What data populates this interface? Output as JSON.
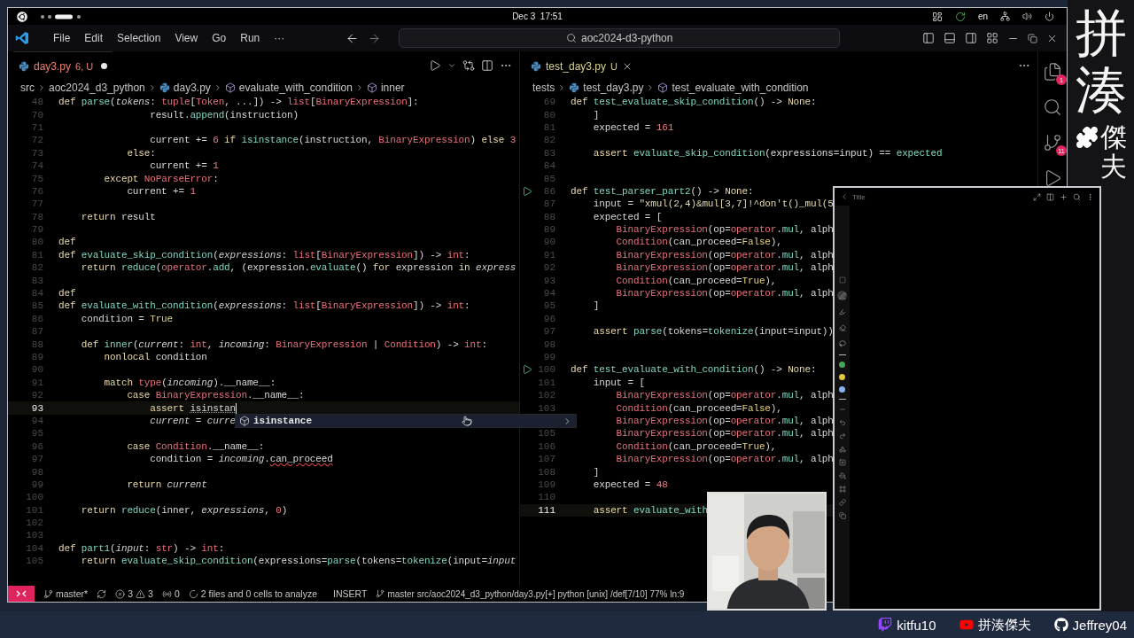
{
  "top_bar": {
    "clock": "Dec 3  17:51",
    "language": "en"
  },
  "window": {
    "menu": [
      "File",
      "Edit",
      "Selection",
      "View",
      "Go",
      "Run",
      "···"
    ],
    "command_center": "aoc2024-d3-python"
  },
  "editors": [
    {
      "focused": true,
      "tabs": [
        {
          "label": "day3.py",
          "detail": "6, U",
          "kind": "error",
          "modified": true,
          "selected": true
        }
      ],
      "actions": [
        {
          "kind": "run"
        },
        {
          "kind": "run-menu"
        },
        {
          "kind": "compare"
        },
        {
          "kind": "split"
        },
        {
          "kind": "more"
        }
      ],
      "breadcrumbs": [
        {
          "label": "src",
          "kind": "folder"
        },
        {
          "label": "aoc2024_d3_python",
          "kind": "folder"
        },
        {
          "label": "day3.py",
          "kind": "python"
        },
        {
          "label": "evaluate_with_condition",
          "kind": "symbol"
        },
        {
          "label": "inner",
          "kind": "symbol"
        }
      ],
      "lines": [
        {
          "n": "48",
          "current": false,
          "tokens": [
            {
              "kind": "kw",
              "text": "def "
            },
            {
              "kind": "fn",
              "text": "parse"
            },
            {
              "kind": "txt",
              "text": "("
            },
            {
              "kind": "param",
              "text": "tokens"
            },
            {
              "kind": "txt",
              "text": ": "
            },
            {
              "kind": "cls",
              "text": "tuple"
            },
            {
              "kind": "txt",
              "text": "["
            },
            {
              "kind": "cls",
              "text": "Token"
            },
            {
              "kind": "txt",
              "text": ", ...]) -> "
            },
            {
              "kind": "cls",
              "text": "list"
            },
            {
              "kind": "txt",
              "text": "["
            },
            {
              "kind": "cls",
              "text": "BinaryExpression"
            },
            {
              "kind": "txt",
              "text": "]:"
            }
          ]
        },
        {
          "n": "70",
          "current": false,
          "tokens": [
            {
              "kind": "txt",
              "text": "                result."
            },
            {
              "kind": "fn",
              "text": "append"
            },
            {
              "kind": "txt",
              "text": "(instruction)"
            }
          ]
        },
        {
          "n": "71",
          "current": false
        },
        {
          "n": "72",
          "current": false,
          "tokens": [
            {
              "kind": "txt",
              "text": "                current += "
            },
            {
              "kind": "num",
              "text": "6"
            },
            {
              "kind": "kw",
              "text": " if "
            },
            {
              "kind": "fn",
              "text": "isinstance"
            },
            {
              "kind": "txt",
              "text": "(instruction, "
            },
            {
              "kind": "cls",
              "text": "BinaryExpression"
            },
            {
              "kind": "txt",
              "text": ") "
            },
            {
              "kind": "kw",
              "text": "else "
            },
            {
              "kind": "num",
              "text": "3"
            }
          ]
        },
        {
          "n": "73",
          "current": false,
          "tokens": [
            {
              "kind": "kw",
              "text": "            else"
            },
            {
              "kind": "txt",
              "text": ":"
            }
          ]
        },
        {
          "n": "74",
          "current": false,
          "tokens": [
            {
              "kind": "txt",
              "text": "                current += "
            },
            {
              "kind": "num",
              "text": "1"
            }
          ]
        },
        {
          "n": "75",
          "current": false,
          "tokens": [
            {
              "kind": "kw",
              "text": "        except "
            },
            {
              "kind": "cls",
              "text": "NoParseError"
            },
            {
              "kind": "txt",
              "text": ":"
            }
          ]
        },
        {
          "n": "76",
          "current": false,
          "tokens": [
            {
              "kind": "txt",
              "text": "            current += "
            },
            {
              "kind": "num",
              "text": "1"
            }
          ]
        },
        {
          "n": "77",
          "current": false
        },
        {
          "n": "78",
          "current": false,
          "tokens": [
            {
              "kind": "kw",
              "text": "    return "
            },
            {
              "kind": "txt",
              "text": "result"
            }
          ]
        },
        {
          "n": "79",
          "current": false
        },
        {
          "n": "80",
          "current": false,
          "tokens": [
            {
              "kind": "kw",
              "text": "def"
            }
          ]
        },
        {
          "n": "81",
          "current": false,
          "tokens": [
            {
              "kind": "kw",
              "text": "def "
            },
            {
              "kind": "fn",
              "text": "evaluate_skip_condition"
            },
            {
              "kind": "txt",
              "text": "("
            },
            {
              "kind": "param",
              "text": "expressions"
            },
            {
              "kind": "txt",
              "text": ": "
            },
            {
              "kind": "cls",
              "text": "list"
            },
            {
              "kind": "txt",
              "text": "["
            },
            {
              "kind": "cls",
              "text": "BinaryExpression"
            },
            {
              "kind": "txt",
              "text": "]) -> "
            },
            {
              "kind": "cls",
              "text": "int"
            },
            {
              "kind": "txt",
              "text": ":"
            }
          ]
        },
        {
          "n": "82",
          "current": false,
          "tokens": [
            {
              "kind": "kw",
              "text": "    return "
            },
            {
              "kind": "fn",
              "text": "reduce"
            },
            {
              "kind": "txt",
              "text": "("
            },
            {
              "kind": "cls",
              "text": "operator"
            },
            {
              "kind": "txt",
              "text": "."
            },
            {
              "kind": "fn",
              "text": "add"
            },
            {
              "kind": "txt",
              "text": ", (expression."
            },
            {
              "kind": "fn",
              "text": "evaluate"
            },
            {
              "kind": "txt",
              "text": "() "
            },
            {
              "kind": "kw",
              "text": "for "
            },
            {
              "kind": "txt",
              "text": "expression "
            },
            {
              "kind": "kw",
              "text": "in "
            },
            {
              "kind": "param",
              "text": "express"
            }
          ]
        },
        {
          "n": "83",
          "current": false
        },
        {
          "n": "84",
          "current": false,
          "tokens": [
            {
              "kind": "kw",
              "text": "def"
            }
          ]
        },
        {
          "n": "85",
          "current": false,
          "tokens": [
            {
              "kind": "kw",
              "text": "def "
            },
            {
              "kind": "fn",
              "text": "evaluate_with_condition"
            },
            {
              "kind": "txt",
              "text": "("
            },
            {
              "kind": "param",
              "text": "expressions"
            },
            {
              "kind": "txt",
              "text": ": "
            },
            {
              "kind": "cls",
              "text": "list"
            },
            {
              "kind": "txt",
              "text": "["
            },
            {
              "kind": "cls",
              "text": "BinaryExpression"
            },
            {
              "kind": "txt",
              "text": "]) -> "
            },
            {
              "kind": "cls",
              "text": "int"
            },
            {
              "kind": "txt",
              "text": ":"
            }
          ]
        },
        {
          "n": "86",
          "current": false,
          "tokens": [
            {
              "kind": "txt",
              "text": "    condition = "
            },
            {
              "kind": "const",
              "text": "True"
            }
          ]
        },
        {
          "n": "87",
          "current": false
        },
        {
          "n": "88",
          "current": false,
          "tokens": [
            {
              "kind": "kw",
              "text": "    def "
            },
            {
              "kind": "fn",
              "text": "inner"
            },
            {
              "kind": "txt",
              "text": "("
            },
            {
              "kind": "param",
              "text": "current"
            },
            {
              "kind": "txt",
              "text": ": "
            },
            {
              "kind": "cls",
              "text": "int"
            },
            {
              "kind": "txt",
              "text": ", "
            },
            {
              "kind": "param",
              "text": "incoming"
            },
            {
              "kind": "txt",
              "text": ": "
            },
            {
              "kind": "cls",
              "text": "BinaryExpression"
            },
            {
              "kind": "txt",
              "text": " | "
            },
            {
              "kind": "cls",
              "text": "Condition"
            },
            {
              "kind": "txt",
              "text": ") -> "
            },
            {
              "kind": "cls",
              "text": "int"
            },
            {
              "kind": "txt",
              "text": ":"
            }
          ]
        },
        {
          "n": "89",
          "current": false,
          "tokens": [
            {
              "kind": "kw",
              "text": "        nonlocal "
            },
            {
              "kind": "txt",
              "text": "condition"
            }
          ]
        },
        {
          "n": "90",
          "current": false
        },
        {
          "n": "91",
          "current": false,
          "tokens": [
            {
              "kind": "kw",
              "text": "        match "
            },
            {
              "kind": "cls",
              "text": "type"
            },
            {
              "kind": "txt",
              "text": "("
            },
            {
              "kind": "param",
              "text": "incoming"
            },
            {
              "kind": "txt",
              "text": ").__name__:"
            }
          ]
        },
        {
          "n": "92",
          "current": false,
          "tokens": [
            {
              "kind": "kw",
              "text": "            case "
            },
            {
              "kind": "cls",
              "text": "BinaryExpression"
            },
            {
              "kind": "txt",
              "text": ".__name__:"
            }
          ]
        },
        {
          "n": "93",
          "current": true,
          "tokens": [
            {
              "kind": "kw",
              "text": "                assert "
            },
            {
              "kind": "hint",
              "text": "isinstan"
            }
          ]
        },
        {
          "n": "94",
          "current": false,
          "tokens": [
            {
              "kind": "param",
              "text": "                current"
            },
            {
              "kind": "txt",
              "text": " = "
            },
            {
              "kind": "param",
              "text": "curre"
            }
          ]
        },
        {
          "n": "95",
          "current": false
        },
        {
          "n": "96",
          "current": false,
          "tokens": [
            {
              "kind": "kw",
              "text": "            case "
            },
            {
              "kind": "cls",
              "text": "Condition"
            },
            {
              "kind": "txt",
              "text": ".__name__:"
            }
          ]
        },
        {
          "n": "97",
          "current": false,
          "tokens": [
            {
              "kind": "txt",
              "text": "                condition = "
            },
            {
              "kind": "param",
              "text": "incoming"
            },
            {
              "kind": "txt",
              "text": "."
            },
            {
              "kind": "err",
              "text": "can_proceed"
            }
          ]
        },
        {
          "n": "98",
          "current": false
        },
        {
          "n": "99",
          "current": false,
          "tokens": [
            {
              "kind": "kw",
              "text": "            return "
            },
            {
              "kind": "param",
              "text": "current"
            }
          ]
        },
        {
          "n": "100",
          "current": false
        },
        {
          "n": "101",
          "current": false,
          "tokens": [
            {
              "kind": "kw",
              "text": "    return "
            },
            {
              "kind": "fn",
              "text": "reduce"
            },
            {
              "kind": "txt",
              "text": "(inner, "
            },
            {
              "kind": "param",
              "text": "expressions"
            },
            {
              "kind": "txt",
              "text": ", "
            },
            {
              "kind": "num",
              "text": "0"
            },
            {
              "kind": "txt",
              "text": ")"
            }
          ]
        },
        {
          "n": "102",
          "current": false
        },
        {
          "n": "103",
          "current": false
        },
        {
          "n": "104",
          "current": false,
          "tokens": [
            {
              "kind": "kw",
              "text": "def "
            },
            {
              "kind": "fn",
              "text": "part1"
            },
            {
              "kind": "txt",
              "text": "("
            },
            {
              "kind": "param",
              "text": "input"
            },
            {
              "kind": "txt",
              "text": ": "
            },
            {
              "kind": "cls",
              "text": "str"
            },
            {
              "kind": "txt",
              "text": ") -> "
            },
            {
              "kind": "cls",
              "text": "int"
            },
            {
              "kind": "txt",
              "text": ":"
            }
          ]
        },
        {
          "n": "105",
          "current": false,
          "tokens": [
            {
              "kind": "kw",
              "text": "    return "
            },
            {
              "kind": "fn",
              "text": "evaluate_skip_condition"
            },
            {
              "kind": "txt",
              "text": "(expressions="
            },
            {
              "kind": "fn",
              "text": "parse"
            },
            {
              "kind": "txt",
              "text": "(tokens="
            },
            {
              "kind": "fn",
              "text": "tokenize"
            },
            {
              "kind": "txt",
              "text": "(input="
            },
            {
              "kind": "param",
              "text": "input"
            }
          ]
        }
      ]
    },
    {
      "focused": false,
      "tabs": [
        {
          "label": "test_day3.py",
          "detail": "U",
          "kind": "untracked",
          "modified": false,
          "selected": true
        }
      ],
      "actions": [
        {
          "kind": "more"
        }
      ],
      "breadcrumbs": [
        {
          "label": "tests",
          "kind": "folder"
        },
        {
          "label": "test_day3.py",
          "kind": "python"
        },
        {
          "label": "test_evaluate_with_condition",
          "kind": "symbol"
        }
      ],
      "lines": [
        {
          "n": "69",
          "current": false,
          "tokens": [
            {
              "kind": "kw",
              "text": "def "
            },
            {
              "kind": "fn",
              "text": "test_evaluate_skip_condition"
            },
            {
              "kind": "txt",
              "text": "() -> "
            },
            {
              "kind": "kw",
              "text": "None"
            },
            {
              "kind": "txt",
              "text": ":"
            }
          ]
        },
        {
          "n": "80",
          "current": false,
          "tokens": [
            {
              "kind": "txt",
              "text": "    ]"
            }
          ]
        },
        {
          "n": "81",
          "current": false,
          "tokens": [
            {
              "kind": "txt",
              "text": "    expected = "
            },
            {
              "kind": "num",
              "text": "161"
            }
          ]
        },
        {
          "n": "82",
          "current": false
        },
        {
          "n": "83",
          "current": false,
          "tokens": [
            {
              "kind": "kw",
              "text": "    assert "
            },
            {
              "kind": "fn",
              "text": "evaluate_skip_condition"
            },
            {
              "kind": "txt",
              "text": "(expressions=input) == "
            },
            {
              "kind": "fn",
              "text": "expected"
            }
          ]
        },
        {
          "n": "84",
          "current": false
        },
        {
          "n": "85",
          "current": false
        },
        {
          "n": "86",
          "current": false,
          "runnable": true,
          "tokens": [
            {
              "kind": "kw",
              "text": "def "
            },
            {
              "kind": "fn",
              "text": "test_parser_part2"
            },
            {
              "kind": "txt",
              "text": "() -> "
            },
            {
              "kind": "kw",
              "text": "None"
            },
            {
              "kind": "txt",
              "text": ":"
            }
          ]
        },
        {
          "n": "87",
          "current": false,
          "tokens": [
            {
              "kind": "txt",
              "text": "    input = "
            },
            {
              "kind": "str",
              "text": "\"xmul(2,4)&mul[3,7]!^don't()_mul(5"
            }
          ]
        },
        {
          "n": "88",
          "current": false,
          "tokens": [
            {
              "kind": "txt",
              "text": "    expected = ["
            }
          ]
        },
        {
          "n": "89",
          "current": false,
          "tokens": [
            {
              "kind": "cls",
              "text": "        BinaryExpression"
            },
            {
              "kind": "txt",
              "text": "(op="
            },
            {
              "kind": "cls",
              "text": "operator"
            },
            {
              "kind": "txt",
              "text": "."
            },
            {
              "kind": "fn",
              "text": "mul"
            },
            {
              "kind": "txt",
              "text": ", alph"
            }
          ]
        },
        {
          "n": "90",
          "current": false,
          "tokens": [
            {
              "kind": "cls",
              "text": "        Condition"
            },
            {
              "kind": "txt",
              "text": "(can_proceed="
            },
            {
              "kind": "const",
              "text": "False"
            },
            {
              "kind": "txt",
              "text": "),"
            }
          ]
        },
        {
          "n": "91",
          "current": false,
          "tokens": [
            {
              "kind": "cls",
              "text": "        BinaryExpression"
            },
            {
              "kind": "txt",
              "text": "(op="
            },
            {
              "kind": "cls",
              "text": "operator"
            },
            {
              "kind": "txt",
              "text": "."
            },
            {
              "kind": "fn",
              "text": "mul"
            },
            {
              "kind": "txt",
              "text": ", alph"
            }
          ]
        },
        {
          "n": "92",
          "current": false,
          "tokens": [
            {
              "kind": "cls",
              "text": "        BinaryExpression"
            },
            {
              "kind": "txt",
              "text": "(op="
            },
            {
              "kind": "cls",
              "text": "operator"
            },
            {
              "kind": "txt",
              "text": "."
            },
            {
              "kind": "fn",
              "text": "mul"
            },
            {
              "kind": "txt",
              "text": ", alph"
            }
          ]
        },
        {
          "n": "93",
          "current": false,
          "tokens": [
            {
              "kind": "cls",
              "text": "        Condition"
            },
            {
              "kind": "txt",
              "text": "(can_proceed="
            },
            {
              "kind": "const",
              "text": "True"
            },
            {
              "kind": "txt",
              "text": "),"
            }
          ]
        },
        {
          "n": "94",
          "current": false,
          "tokens": [
            {
              "kind": "cls",
              "text": "        BinaryExpression"
            },
            {
              "kind": "txt",
              "text": "(op="
            },
            {
              "kind": "cls",
              "text": "operator"
            },
            {
              "kind": "txt",
              "text": "."
            },
            {
              "kind": "fn",
              "text": "mul"
            },
            {
              "kind": "txt",
              "text": ", alph"
            }
          ]
        },
        {
          "n": "95",
          "current": false,
          "tokens": [
            {
              "kind": "txt",
              "text": "    ]"
            }
          ]
        },
        {
          "n": "96",
          "current": false
        },
        {
          "n": "97",
          "current": false,
          "tokens": [
            {
              "kind": "kw",
              "text": "    assert "
            },
            {
              "kind": "fn",
              "text": "parse"
            },
            {
              "kind": "txt",
              "text": "(tokens="
            },
            {
              "kind": "fn",
              "text": "tokenize"
            },
            {
              "kind": "txt",
              "text": "(input=input))"
            }
          ]
        },
        {
          "n": "98",
          "current": false
        },
        {
          "n": "99",
          "current": false
        },
        {
          "n": "100",
          "current": false,
          "runnable": true,
          "tokens": [
            {
              "kind": "kw",
              "text": "def "
            },
            {
              "kind": "fn",
              "text": "test_evaluate_with_condition"
            },
            {
              "kind": "txt",
              "text": "() -> "
            },
            {
              "kind": "kw",
              "text": "None"
            },
            {
              "kind": "txt",
              "text": ":"
            }
          ]
        },
        {
          "n": "101",
          "current": false,
          "tokens": [
            {
              "kind": "txt",
              "text": "    input = ["
            }
          ]
        },
        {
          "n": "102",
          "current": false,
          "tokens": [
            {
              "kind": "cls",
              "text": "        BinaryExpression"
            },
            {
              "kind": "txt",
              "text": "(op="
            },
            {
              "kind": "cls",
              "text": "operator"
            },
            {
              "kind": "txt",
              "text": "."
            },
            {
              "kind": "fn",
              "text": "mul"
            },
            {
              "kind": "txt",
              "text": ", alph"
            }
          ]
        },
        {
          "n": "103",
          "current": false,
          "tokens": [
            {
              "kind": "cls",
              "text": "        Condition"
            },
            {
              "kind": "txt",
              "text": "(can_proceed="
            },
            {
              "kind": "const",
              "text": "False"
            },
            {
              "kind": "txt",
              "text": "),"
            }
          ]
        },
        {
          "current": false,
          "tokens": [
            {
              "kind": "cls",
              "text": "        BinaryExpression"
            },
            {
              "kind": "txt",
              "text": "(op="
            },
            {
              "kind": "cls",
              "text": "operator"
            },
            {
              "kind": "txt",
              "text": "."
            },
            {
              "kind": "fn",
              "text": "mul"
            },
            {
              "kind": "txt",
              "text": ", alph"
            }
          ]
        },
        {
          "n": "105",
          "current": false,
          "tokens": [
            {
              "kind": "cls",
              "text": "        BinaryExpression"
            },
            {
              "kind": "txt",
              "text": "(op="
            },
            {
              "kind": "cls",
              "text": "operator"
            },
            {
              "kind": "txt",
              "text": "."
            },
            {
              "kind": "fn",
              "text": "mul"
            },
            {
              "kind": "txt",
              "text": ", alph"
            }
          ]
        },
        {
          "n": "106",
          "current": false,
          "tokens": [
            {
              "kind": "cls",
              "text": "        Condition"
            },
            {
              "kind": "txt",
              "text": "(can_proceed="
            },
            {
              "kind": "const",
              "text": "True"
            },
            {
              "kind": "txt",
              "text": "),"
            }
          ]
        },
        {
          "n": "107",
          "current": false,
          "tokens": [
            {
              "kind": "cls",
              "text": "        BinaryExpression"
            },
            {
              "kind": "txt",
              "text": "(op="
            },
            {
              "kind": "cls",
              "text": "operator"
            },
            {
              "kind": "txt",
              "text": "."
            },
            {
              "kind": "fn",
              "text": "mul"
            },
            {
              "kind": "txt",
              "text": ", alph"
            }
          ]
        },
        {
          "n": "108",
          "current": false,
          "tokens": [
            {
              "kind": "txt",
              "text": "    ]"
            }
          ]
        },
        {
          "n": "109",
          "current": false,
          "tokens": [
            {
              "kind": "txt",
              "text": "    expected = "
            },
            {
              "kind": "num",
              "text": "48"
            }
          ]
        },
        {
          "n": "110",
          "current": false
        },
        {
          "n": "111",
          "current": true,
          "tokens": [
            {
              "kind": "kw",
              "text": "    assert "
            },
            {
              "kind": "fn",
              "text": "evaluate_with"
            }
          ]
        }
      ]
    }
  ],
  "activity_bar": [
    {
      "kind": "explorer",
      "badge": "1"
    },
    {
      "kind": "search"
    },
    {
      "kind": "source-control",
      "badge": "11"
    },
    {
      "kind": "run"
    }
  ],
  "autocomplete": {
    "items": [
      {
        "label": "isinstance",
        "selected": true
      }
    ]
  },
  "status_bar": {
    "branch": "master*",
    "errors": "3",
    "warnings": "3",
    "ports": "0",
    "analysis": "2 files and 0 cells to analyze",
    "mode": "INSERT",
    "vim_status": "master src/aoc2024_d3_python/day3.py[+] python [unix] /def[7/10] 77% ln:9"
  },
  "notes_window": {
    "title": "Title",
    "actions": [
      {
        "kind": "expand"
      },
      {
        "kind": "split"
      },
      {
        "kind": "add"
      },
      {
        "kind": "search"
      },
      {
        "kind": "more"
      }
    ],
    "tools": [
      {
        "kind": "select",
        "selected": false
      },
      {
        "kind": "pen",
        "selected": true
      },
      {
        "kind": "marker",
        "selected": false
      },
      {
        "kind": "eraser",
        "selected": false
      },
      {
        "kind": "lasso",
        "selected": false
      }
    ],
    "colors": [
      {
        "color": "#43a85a"
      },
      {
        "color": "#e2c93a"
      },
      {
        "color": "#8ab4f0"
      }
    ],
    "more_tools": [
      {
        "kind": "line"
      },
      {
        "kind": "undo"
      },
      {
        "kind": "redo"
      },
      {
        "kind": "shapes"
      },
      {
        "kind": "shape-add"
      },
      {
        "kind": "fill"
      },
      {
        "kind": "frame"
      },
      {
        "kind": "link"
      },
      {
        "kind": "copy"
      }
    ]
  },
  "brand": {
    "title": "拼湊",
    "subtitle": "傑夫"
  },
  "socials": [
    {
      "kind": "twitch",
      "label": "kitfu10"
    },
    {
      "kind": "youtube",
      "label": "拼湊傑夫"
    },
    {
      "kind": "github",
      "label": "Jeffrey04"
    }
  ]
}
